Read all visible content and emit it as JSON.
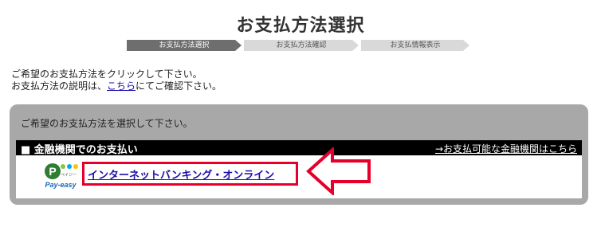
{
  "page": {
    "title": "お支払方法選択"
  },
  "steps": [
    {
      "label": "お支払方法選択",
      "active": true
    },
    {
      "label": "お支払方法確認",
      "active": false
    },
    {
      "label": "お支払情報表示",
      "active": false
    }
  ],
  "intro": {
    "line1": "ご希望のお支払方法をクリックして下さい。",
    "line2_prefix": "お支払方法の説明は、",
    "line2_link": "こちら",
    "line2_suffix": "にてご確認下さい。"
  },
  "panel": {
    "instruction": "ご希望のお支払方法を選択して下さい。",
    "section": {
      "title": "■ 金融機関でのお支払い",
      "link": "→お支払可能な金融機関はこちら"
    },
    "method": {
      "label": "インターネットバンキング・オンライン",
      "logo_text": "Pay-easy",
      "logo_small": "ペイジー"
    }
  },
  "colors": {
    "highlight": "#e4002b",
    "panel": "#a8a8a8",
    "link": "#1a0dab",
    "step_active": "#6e6e6e",
    "step_inactive": "#d9d9d9"
  }
}
